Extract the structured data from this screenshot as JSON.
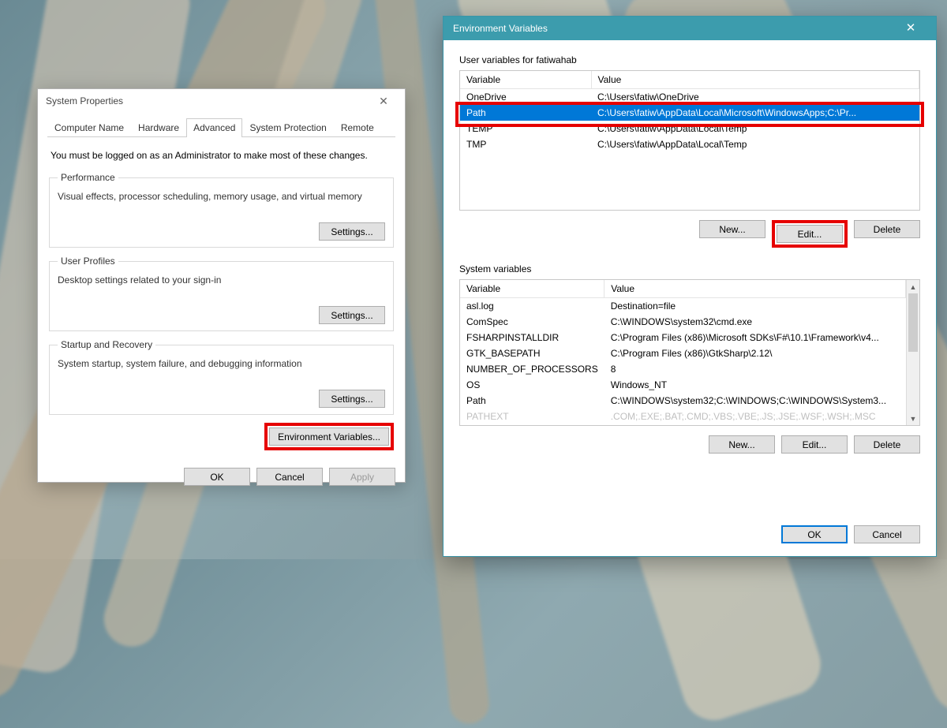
{
  "sysprop": {
    "title": "System Properties",
    "tabs": [
      "Computer Name",
      "Hardware",
      "Advanced",
      "System Protection",
      "Remote"
    ],
    "active_tab": 2,
    "note": "You must be logged on as an Administrator to make most of these changes.",
    "performance": {
      "legend": "Performance",
      "desc": "Visual effects, processor scheduling, memory usage, and virtual memory",
      "button": "Settings..."
    },
    "userprofiles": {
      "legend": "User Profiles",
      "desc": "Desktop settings related to your sign-in",
      "button": "Settings..."
    },
    "startup": {
      "legend": "Startup and Recovery",
      "desc": "System startup, system failure, and debugging information",
      "button": "Settings..."
    },
    "env_button": "Environment Variables...",
    "footer": {
      "ok": "OK",
      "cancel": "Cancel",
      "apply": "Apply"
    }
  },
  "env": {
    "title": "Environment Variables",
    "user_label": "User variables for fatiwahab",
    "headers": {
      "variable": "Variable",
      "value": "Value"
    },
    "user_vars": [
      {
        "name": "OneDrive",
        "value": "C:\\Users\\fatiw\\OneDrive"
      },
      {
        "name": "Path",
        "value": "C:\\Users\\fatiw\\AppData\\Local\\Microsoft\\WindowsApps;C:\\Pr..."
      },
      {
        "name": "TEMP",
        "value": "C:\\Users\\fatiw\\AppData\\Local\\Temp"
      },
      {
        "name": "TMP",
        "value": "C:\\Users\\fatiw\\AppData\\Local\\Temp"
      }
    ],
    "user_selected": 1,
    "sys_label": "System variables",
    "sys_vars": [
      {
        "name": "asl.log",
        "value": "Destination=file"
      },
      {
        "name": "ComSpec",
        "value": "C:\\WINDOWS\\system32\\cmd.exe"
      },
      {
        "name": "FSHARPINSTALLDIR",
        "value": "C:\\Program Files (x86)\\Microsoft SDKs\\F#\\10.1\\Framework\\v4..."
      },
      {
        "name": "GTK_BASEPATH",
        "value": "C:\\Program Files (x86)\\GtkSharp\\2.12\\"
      },
      {
        "name": "NUMBER_OF_PROCESSORS",
        "value": "8"
      },
      {
        "name": "OS",
        "value": "Windows_NT"
      },
      {
        "name": "Path",
        "value": "C:\\WINDOWS\\system32;C:\\WINDOWS;C:\\WINDOWS\\System3..."
      },
      {
        "name": "PATHEXT",
        "value": ".COM;.EXE;.BAT;.CMD;.VBS;.VBE;.JS;.JSE;.WSF;.WSH;.MSC"
      }
    ],
    "buttons": {
      "new": "New...",
      "edit": "Edit...",
      "delete": "Delete",
      "ok": "OK",
      "cancel": "Cancel"
    }
  }
}
